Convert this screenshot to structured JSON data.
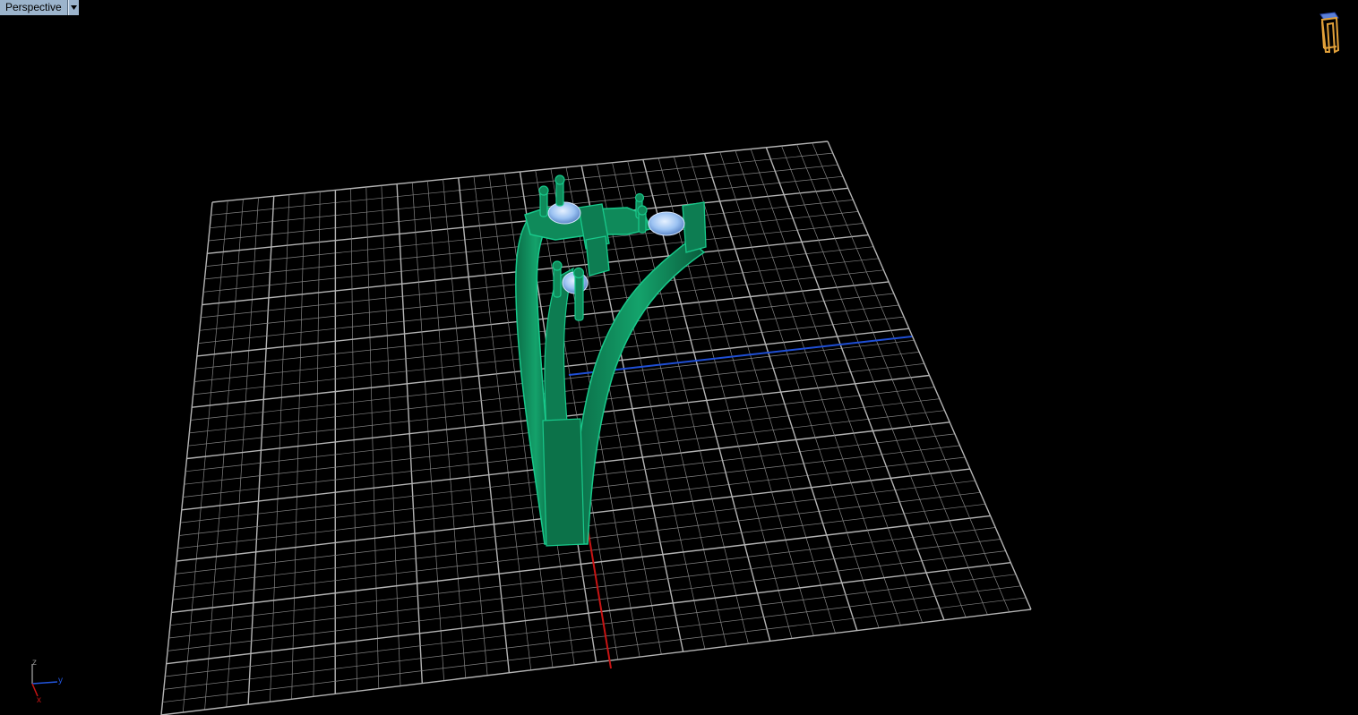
{
  "viewport": {
    "title": "Perspective",
    "background": "#000000",
    "dropdown_icon": "triangle-down-icon"
  },
  "axes": {
    "x_label": "x",
    "y_label": "y",
    "z_label": "z",
    "x_color": "#c81414",
    "y_color": "#2255dd",
    "z_color": "#8a8a8a"
  },
  "colors": {
    "grid": "#b8b8b8",
    "model": "#0f8a5a",
    "model_edge": "#16c487",
    "gem": "#9bc2f2",
    "tab_bg": "#9cb4cc",
    "nav_widget": "#e2a13a"
  },
  "navigation": {
    "widget_icon": "view-cube-icon"
  }
}
